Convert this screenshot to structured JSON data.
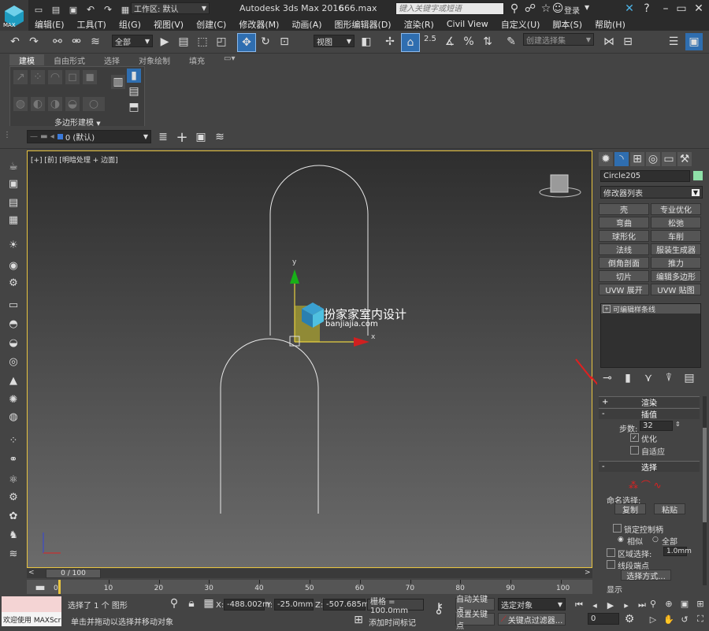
{
  "titlebar": {
    "workspace_label": "工作区: 默认",
    "app_title": "Autodesk 3ds Max 2016",
    "file_name": "666.max",
    "search_placeholder": "键入关键字或短语",
    "login": "登录",
    "help": "?"
  },
  "logo": {
    "text": "MAX"
  },
  "menu": [
    "编辑(E)",
    "工具(T)",
    "组(G)",
    "视图(V)",
    "创建(C)",
    "修改器(M)",
    "动画(A)",
    "图形编辑器(D)",
    "渲染(R)",
    "Civil View",
    "自定义(U)",
    "脚本(S)",
    "帮助(H)"
  ],
  "toolbar": {
    "selection_filter": "全部",
    "ref_coord": "视图",
    "named_selection": "创建选择集",
    "snap_value": "2.5"
  },
  "ribbon": {
    "tabs": [
      "建模",
      "自由形式",
      "选择",
      "对象绘制",
      "填充"
    ],
    "panel_label": "多边形建模"
  },
  "layer": {
    "current": "0 (默认)"
  },
  "viewport": {
    "label": "[+] [前] [明暗处理 + 边面]",
    "axis_y": "y",
    "axis_x": "x",
    "watermark_cn": "扮家家室内设计",
    "watermark_en": "banjiajia.com"
  },
  "cmd": {
    "object_name": "Circle205",
    "modifier_list": "修改器列表",
    "modifier_buttons": [
      "壳",
      "专业优化",
      "弯曲",
      "松弛",
      "球形化",
      "车削",
      "法线",
      "服装生成器",
      "倒角剖面",
      "推力",
      "切片",
      "编辑多边形",
      "UVW 展开",
      "UVW 贴图"
    ],
    "stack_item": "可编辑样条线",
    "rollouts": {
      "render": "渲染",
      "interp": "插值",
      "steps_label": "步数:",
      "steps_value": "32",
      "optimize": "优化",
      "adaptive": "自适应",
      "selection": "选择",
      "named_sel": "命名选择:",
      "copy": "复制",
      "paste": "粘贴",
      "lock_handles": "锁定控制柄",
      "similar": "相似",
      "all": "全部",
      "area_sel": "区域选择:",
      "area_value": "1.0mm",
      "seg_end": "线段端点",
      "sel_method": "选择方式...",
      "display": "显示"
    }
  },
  "timeline": {
    "frame_counter": "0 / 100",
    "ticks": [
      "0",
      "10",
      "20",
      "30",
      "40",
      "50",
      "60",
      "70",
      "80",
      "90",
      "100"
    ]
  },
  "status": {
    "welcome": "欢迎使用 MAXScr",
    "selected": "选择了 1 个 图形",
    "hint": "单击并拖动以选择并移动对象",
    "x_label": "X:",
    "x_value": "-488.002m",
    "y_label": "Y:",
    "y_value": "-25.0mm",
    "z_label": "Z:",
    "z_value": "-507.685m",
    "grid": "栅格 = 100.0mm",
    "add_time_tag": "添加时间标记",
    "auto_key": "自动关键点",
    "set_key": "设置关键点",
    "selected_obj": "选定对象",
    "key_filters": "关键点过滤器...",
    "frame": "0"
  }
}
